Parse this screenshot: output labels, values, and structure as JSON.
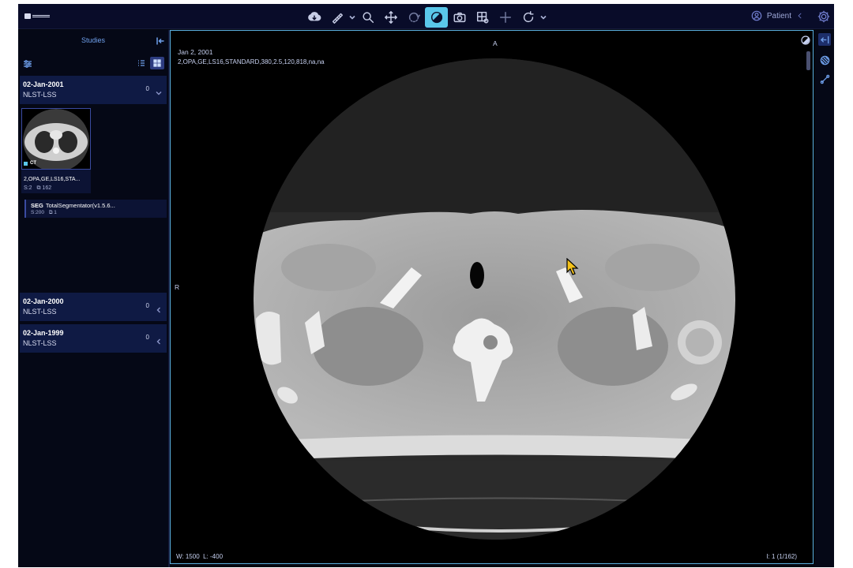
{
  "toolbar": {
    "tools": [
      {
        "name": "download-icon"
      },
      {
        "name": "ruler-icon"
      },
      {
        "name": "zoom-icon"
      },
      {
        "name": "pan-icon"
      },
      {
        "name": "rotate-3d-icon"
      },
      {
        "name": "window-level-icon",
        "active": true
      },
      {
        "name": "camera-icon"
      },
      {
        "name": "layout-icon"
      },
      {
        "name": "crosshair-icon"
      },
      {
        "name": "reset-icon"
      }
    ],
    "patient_label": "Patient"
  },
  "left_panel": {
    "title": "Studies",
    "studies": [
      {
        "date": "02-Jan-2001",
        "name": "NLST-LSS",
        "count": "0",
        "expanded": true
      },
      {
        "date": "02-Jan-2000",
        "name": "NLST-LSS",
        "count": "0",
        "expanded": false
      },
      {
        "date": "02-Jan-1999",
        "name": "NLST-LSS",
        "count": "0",
        "expanded": false
      }
    ],
    "series": {
      "modality": "CT",
      "description": "2,OPA,GE,LS16,STA...",
      "series_number": "S:2",
      "instances": "162"
    },
    "segmentation": {
      "modality": "SEG",
      "description": "TotalSegmentator(v1.5.6...",
      "series_number": "S:200",
      "instances": "1"
    }
  },
  "viewport": {
    "orientation_top": "A",
    "orientation_left": "R",
    "study_date": "Jan 2, 2001",
    "series_info": "2,OPA,GE,LS16,STANDARD,380,2.5,120,818,na,na",
    "window": "W: 1500",
    "level": "L: -400",
    "instance": "I: 1 (1/162)"
  },
  "colors": {
    "accent": "#5ac7ea",
    "panel_bg": "#050816",
    "study_bg": "#0f1a44",
    "topbar_bg": "#090c29",
    "link": "#6fa0ec"
  }
}
